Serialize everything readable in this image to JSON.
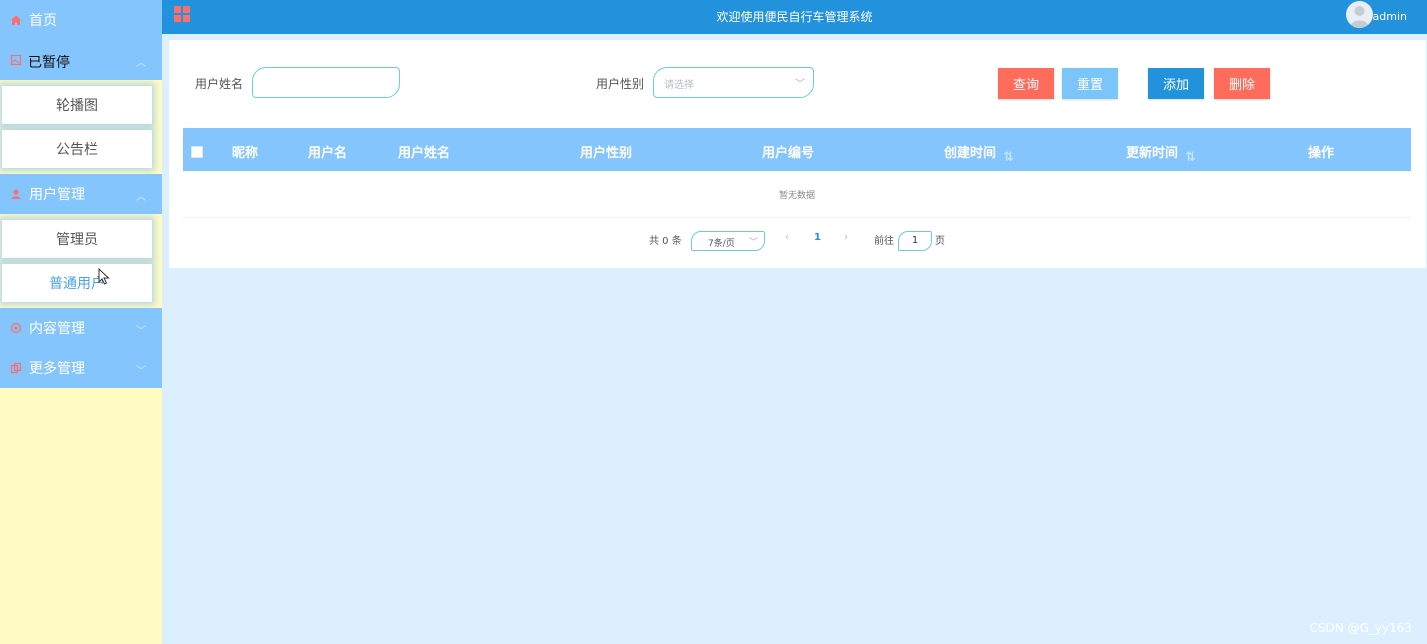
{
  "sidebar": {
    "home": "首页",
    "group1": {
      "overlay": "已暂停",
      "items": [
        "轮播图",
        "公告栏"
      ]
    },
    "user_mgmt": {
      "label": "用户管理",
      "items": [
        "管理员",
        "普通用户"
      ]
    },
    "content_mgmt": "内容管理",
    "more_mgmt": "更多管理"
  },
  "header": {
    "title": "欢迎使用便民自行车管理系统",
    "user": "admin"
  },
  "filters": {
    "name_label": "用户姓名",
    "name_value": "",
    "gender_label": "用户性别",
    "gender_placeholder": "请选择"
  },
  "buttons": {
    "query": "查询",
    "reset": "重置",
    "add": "添加",
    "delete": "删除"
  },
  "table": {
    "columns": [
      "昵称",
      "用户名",
      "用户姓名",
      "用户性别",
      "用户编号",
      "创建时间",
      "更新时间",
      "操作"
    ],
    "empty_text": "暂无数据"
  },
  "pagination": {
    "total": "共 0 条",
    "page_size": "7条/页",
    "current_page": "1",
    "goto_label": "前往",
    "goto_value": "1",
    "page_suffix": "页"
  },
  "watermark": "CSDN @G_yy163",
  "colors": {
    "sidebar_bg": "#fffbc2",
    "menu_head": "#85c5fd",
    "topbar": "#2292dd",
    "content_bg": "#dcefff",
    "query_btn": "#ff6c5c",
    "reset_btn": "#7cc5fb",
    "add_btn": "#2292dd",
    "delete_btn": "#ff6c5c"
  }
}
